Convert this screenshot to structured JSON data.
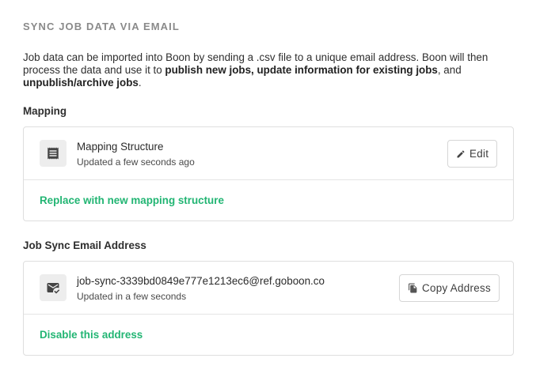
{
  "section_title": "SYNC JOB DATA VIA EMAIL",
  "intro": {
    "part1": "Job data can be imported into Boon by sending a .csv file to a unique email address. Boon will then process the data and use it to ",
    "bold1": "publish new jobs, update information for existing jobs",
    "part2": ", and ",
    "bold2": "unpublish/archive jobs",
    "part3": "."
  },
  "mapping": {
    "heading": "Mapping",
    "item_title": "Mapping Structure",
    "item_subtitle": "Updated a few seconds ago",
    "icon": "receipt-icon",
    "edit_label": "Edit",
    "edit_icon": "pencil-icon",
    "link_label": "Replace with new mapping structure"
  },
  "email": {
    "heading": "Job Sync Email Address",
    "address": "job-sync-3339bd0849e777e1213ec6@ref.goboon.co",
    "item_subtitle": "Updated in a few seconds",
    "icon": "mark-email-read-icon",
    "copy_label": "Copy Address",
    "copy_icon": "copy-icon",
    "link_label": "Disable this address"
  },
  "colors": {
    "accent_green": "#22b573",
    "muted_heading": "#8a8a8a",
    "border": "#dedede",
    "icon_tile": "#ededed"
  }
}
